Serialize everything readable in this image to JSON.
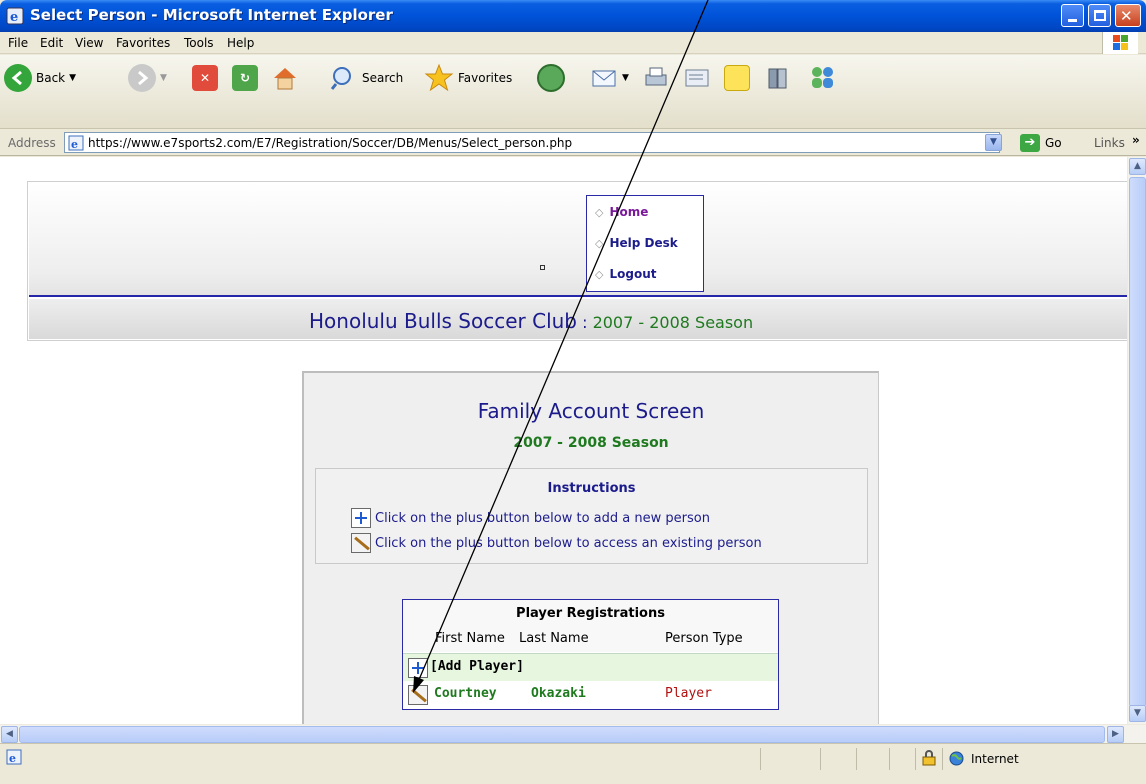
{
  "window": {
    "title": "Select Person - Microsoft Internet Explorer"
  },
  "menu": [
    "File",
    "Edit",
    "View",
    "Favorites",
    "Tools",
    "Help"
  ],
  "toolbar": {
    "back": "Back",
    "search": "Search",
    "favorites": "Favorites"
  },
  "address": {
    "label": "Address",
    "url": "https://www.e7sports2.com/E7/Registration/Soccer/DB/Menus/Select_person.php",
    "go": "Go",
    "links": "Links"
  },
  "header": {
    "nav": [
      "Home",
      "Help Desk",
      "Logout"
    ],
    "club_name": "Honolulu Bulls Soccer Club",
    "separator": " : ",
    "season": "2007 - 2008 Season"
  },
  "panel": {
    "title": "Family Account Screen",
    "season": "2007 - 2008 Season",
    "instructions": {
      "heading": "Instructions",
      "add_text": "Click on the plus button below to add a new person",
      "access_text": "Click on the plus button below to access an existing person"
    },
    "registrations": {
      "title": "Player Registrations",
      "columns": [
        "First Name",
        "Last Name",
        "Person Type"
      ],
      "add_label": "[Add Player]",
      "rows": [
        {
          "first": "Courtney",
          "last": "Okazaki",
          "type": "Player"
        }
      ]
    }
  },
  "status": {
    "zone": "Internet"
  },
  "colors": {
    "title_bar": "#0053d8",
    "club": "#1b1b8c",
    "season": "#1f7a1f",
    "person_type": "#b01010"
  }
}
